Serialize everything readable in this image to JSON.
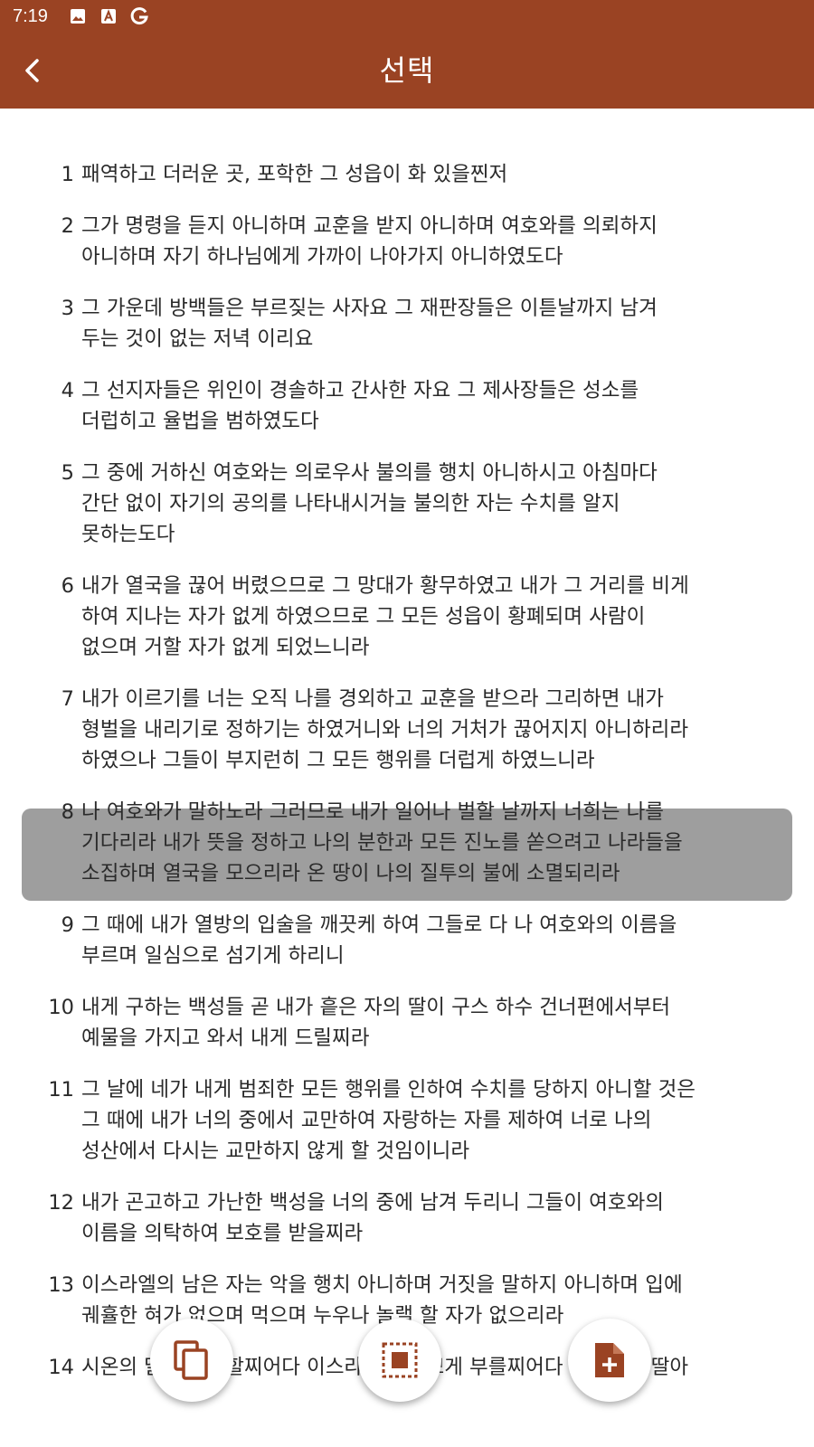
{
  "status_bar": {
    "time": "7:19",
    "icons": [
      "image-icon",
      "font-app-icon",
      "google-icon"
    ]
  },
  "app_bar": {
    "title": "선택",
    "back_icon": "back-arrow-icon"
  },
  "colors": {
    "primary": "#9a4323",
    "highlight": "#9e9e9e",
    "icon_accent": "#9a4323"
  },
  "verses": [
    {
      "num": "1",
      "lines": [
        "패역하고 더러운 곳, 포학한 그 성읍이 화 있을찐저"
      ]
    },
    {
      "num": "2",
      "lines": [
        "그가 명령을 듣지 아니하며 교훈을 받지 아니하며 여호와를 의뢰하지",
        "아니하며 자기 하나님에게 가까이 나아가지 아니하였도다"
      ]
    },
    {
      "num": "3",
      "lines": [
        "그 가운데 방백들은 부르짖는 사자요 그 재판장들은 이튿날까지 남겨",
        "두는 것이 없는 저녁 이리요"
      ]
    },
    {
      "num": "4",
      "lines": [
        "그 선지자들은 위인이 경솔하고 간사한 자요 그 제사장들은 성소를",
        "더럽히고 율법을 범하였도다"
      ]
    },
    {
      "num": "5",
      "lines": [
        "그 중에 거하신 여호와는 의로우사 불의를 행치 아니하시고 아침마다",
        "간단 없이 자기의 공의를 나타내시거늘 불의한 자는 수치를 알지",
        "못하는도다"
      ]
    },
    {
      "num": "6",
      "lines": [
        "내가 열국을 끊어 버렸으므로 그 망대가 황무하였고 내가 그 거리를 비게",
        "하여 지나는 자가 없게 하였으므로 그 모든 성읍이 황폐되며 사람이",
        "없으며 거할 자가 없게 되었느니라"
      ]
    },
    {
      "num": "7",
      "lines": [
        "내가 이르기를 너는 오직 나를 경외하고 교훈을 받으라 그리하면 내가",
        "형벌을 내리기로 정하기는 하였거니와 너의 거처가 끊어지지 아니하리라",
        "하였으나 그들이 부지런히 그 모든 행위를 더럽게 하였느니라"
      ]
    },
    {
      "num": "8",
      "lines": [
        "나 여호와가 말하노라 그러므로 내가 일어나 벌할 날까지 너희는 나를",
        "기다리라 내가 뜻을 정하고 나의 분한과 모든 진노를 쏟으려고 나라들을",
        "소집하며 열국을 모으리라 온 땅이 나의 질투의 불에 소멸되리라"
      ]
    },
    {
      "num": "9",
      "lines": [
        "그 때에 내가 열방의 입술을 깨끗케 하여 그들로 다 나 여호와의 이름을",
        "부르며 일심으로 섬기게 하리니"
      ]
    },
    {
      "num": "10",
      "lines": [
        "내게 구하는 백성들 곧 내가 흩은 자의 딸이 구스 하수 건너편에서부터",
        "예물을 가지고 와서 내게 드릴찌라"
      ]
    },
    {
      "num": "11",
      "lines": [
        "그 날에 네가 내게 범죄한 모든 행위를 인하여 수치를 당하지 아니할 것은",
        "그 때에 내가 너의 중에서 교만하여 자랑하는 자를 제하여 너로 나의",
        "성산에서 다시는 교만하지 않게 할 것임이니라"
      ]
    },
    {
      "num": "12",
      "lines": [
        "내가 곤고하고 가난한 백성을 너의 중에 남겨 두리니 그들이 여호와의",
        "이름을 의탁하여 보호를 받을찌라"
      ]
    },
    {
      "num": "13",
      "lines": [
        "이스라엘의 남은 자는 악을 행치 아니하며 거짓을 말하지 아니하며 입에",
        "궤휼한 혀가 없으며 먹으며 누우나 놀랠 할 자가 없으리라"
      ]
    },
    {
      "num": "14",
      "lines": [
        "시온의 딸아 노래할찌어다 이스라엘아 기쁘게 부를찌어다 예루살렘 딸아"
      ]
    }
  ],
  "selected_verse": "7",
  "fabs": [
    {
      "name": "copy-button",
      "icon": "copy-icon"
    },
    {
      "name": "select-all-button",
      "icon": "select-all-icon"
    },
    {
      "name": "add-note-button",
      "icon": "note-add-icon"
    }
  ]
}
